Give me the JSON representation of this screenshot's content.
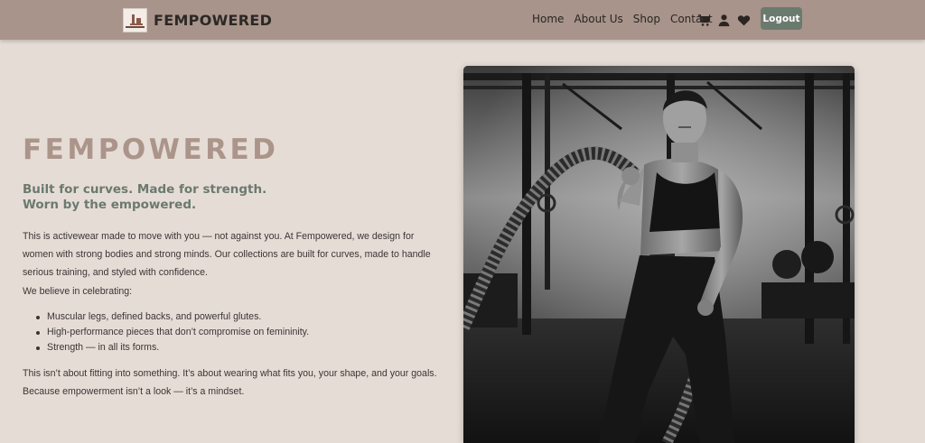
{
  "navbar": {
    "brand": "FEMPOWERED",
    "logo_icon": "fempowered-logo",
    "links": [
      {
        "label": "Home"
      },
      {
        "label": "About Us"
      },
      {
        "label": "Shop"
      },
      {
        "label": "Contact"
      }
    ],
    "icons": [
      "cart-icon",
      "user-icon",
      "heart-icon"
    ],
    "logout_label": "Logout"
  },
  "hero": {
    "title": "FEMPOWERED",
    "tagline_line1": "Built for curves. Made for strength.",
    "tagline_line2": "Worn by the empowered.",
    "paragraph1": "This is activewear made to move with you — not against you. At Fempowered, we design for women with strong bodies and strong minds. Our collections are built for curves, made to handle serious training, and styled with confidence.",
    "paragraph2": "We believe in celebrating:",
    "bullets": [
      "Muscular legs, defined backs, and powerful glutes.",
      "High-performance pieces that don’t compromise on femininity.",
      "Strength — in all its forms."
    ],
    "paragraph3": "This isn’t about fitting into something. It’s about wearing what fits you, your shape, and your goals. Because empowerment isn’t a look — it’s a mindset."
  },
  "colors": {
    "navbar_bg": "#a8948a",
    "page_bg": "#e6dcd6",
    "accent_title": "#ab958b",
    "accent_green": "#6b7a6e",
    "logout_bg": "#6b7a6e"
  }
}
